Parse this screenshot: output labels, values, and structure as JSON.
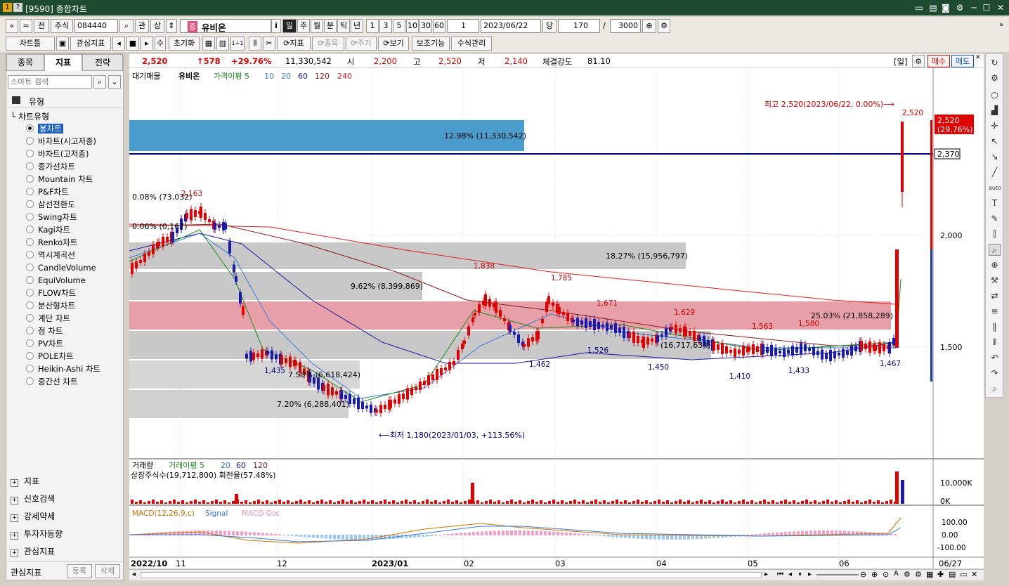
{
  "window": {
    "title": "[9590] 종합차트",
    "icons": [
      "1",
      "?"
    ]
  },
  "toolbar1": {
    "nav_first": "«",
    "nav_prev": "≈",
    "before": "전",
    "market": "주식",
    "code": "084440",
    "search_icon": "⌕",
    "gwan": "관",
    "sang": "상",
    "badge": "증",
    "stock_name": "유비온",
    "info": "i",
    "periods": [
      "일",
      "주",
      "월",
      "분",
      "틱",
      "년"
    ],
    "intervals": [
      "1",
      "3",
      "5",
      "10",
      "30",
      "60"
    ],
    "count_select": "1",
    "date": "2023/06/22",
    "dang": "당",
    "bars": "170",
    "slash": "/",
    "total": "3000"
  },
  "toolbar2": {
    "chart_type": "차트틀",
    "watch_indicator": "관심지표",
    "su": "수",
    "reset": "초기화",
    "indicator": "지표",
    "stock": "종목",
    "cycle": "주기",
    "view": "보기",
    "aux": "보조기능",
    "formula": "수식관리"
  },
  "left_panel": {
    "tabs": [
      "종목",
      "지표",
      "전략"
    ],
    "search_placeholder": "스마트 검색",
    "section_type": "유형",
    "tree_root": "차트유형",
    "items": [
      "봉차트",
      "바차트(시고저종)",
      "바차트(고저종)",
      "종가선차트",
      "Mountain 차트",
      "P&F차트",
      "삼선전환도",
      "Swing차트",
      "Kagi차트",
      "Renko차트",
      "역시계곡선",
      "CandleVolume",
      "EquiVolume",
      "FLOW차트",
      "분산형차트",
      "계단 차트",
      "점 차트",
      "PV차트",
      "POLE차트",
      "Heikin-Ashi 차트",
      "중간선 차트"
    ],
    "selected_index": 0,
    "sections": [
      "지표",
      "신호검색",
      "강세약세",
      "투자자동향",
      "관심지표"
    ],
    "bottom": {
      "label": "관심지표",
      "register": "등록",
      "delete": "삭제"
    }
  },
  "infobar": {
    "price": "2,520",
    "change": "↑578",
    "pct": "+29.76%",
    "volume": "11,330,542",
    "open_label": "시",
    "open": "2,200",
    "high_label": "고",
    "high": "2,520",
    "low_label": "저",
    "low": "2,140",
    "strength_label": "체결강도",
    "strength": "81.10",
    "day": "[일]",
    "buy": "매수",
    "sell": "매도"
  },
  "chart_legend": {
    "items": [
      "대기매물",
      "유비온",
      "가격이평 5",
      "10",
      "20",
      "60",
      "120",
      "240"
    ],
    "colors": [
      "#000",
      "#000",
      "#1a8a1a",
      "#3a78d8",
      "#3a78d8",
      "#1a1aa0",
      "#8a1a1a",
      "#e02020"
    ]
  },
  "chart_annotations": {
    "high": "최고 2,520(2023/06/22, 0.00%)⟶",
    "low": "⟵최저 1,180(2023/01/03, +113.56%)",
    "price_tag": "2,520",
    "price_pct": "(29.76%)",
    "line_tag": "2,370",
    "bars": [
      "12.98% (11,330,542)",
      "0.08% (73,032)",
      "0.06% (0,167)",
      "18.27% (15,956,797)",
      "9.62% (8,399,869)",
      "25.03% (21,858,289)",
      "(16,717,634)",
      "7.58% (6,618,424)",
      "7.20% (6,288,401)"
    ],
    "peaks": [
      "2,163",
      "1,838",
      "1,785",
      "1,671",
      "1,629",
      "1,563",
      "1,580",
      "2,520"
    ],
    "troughs": [
      "1,435",
      "1,462",
      "1,526",
      "1,450",
      "1,410",
      "1,433",
      "1,467"
    ]
  },
  "price_axis": [
    "2,000",
    "1,500"
  ],
  "volume_panel": {
    "legend": [
      "거래량",
      "거래이평 5",
      "20",
      "60",
      "120"
    ],
    "info": "상장주식수(19,712,800) 회전율(57.48%)",
    "axis": [
      "10,000K",
      "0K"
    ]
  },
  "macd_panel": {
    "legend": [
      "MACD(12,26,9,c)",
      "Signal",
      "MACD Osc"
    ],
    "axis": [
      "100.00",
      "0.00",
      "-100.00"
    ]
  },
  "x_axis": {
    "labels": [
      "2022/10",
      "11",
      "12",
      "2023/01",
      "02",
      "03",
      "04",
      "05",
      "06",
      "06/27"
    ]
  },
  "chart_data": {
    "type": "candlestick",
    "title": "유비온",
    "date_range": [
      "2022/10",
      "2023/06/22"
    ],
    "ylim": [
      1100,
      2600
    ],
    "last": 2520,
    "high": {
      "value": 2520,
      "date": "2023/06/22"
    },
    "low": {
      "value": 1180,
      "date": "2023/01/03"
    },
    "reference_line": 2370,
    "volume_profile": [
      {
        "pct": 12.98,
        "volume": 11330542
      },
      {
        "pct": 18.27,
        "volume": 15956797
      },
      {
        "pct": 9.62,
        "volume": 8399869
      },
      {
        "pct": 25.03,
        "volume": 21858289
      },
      {
        "pct": 7.58,
        "volume": 6618424
      },
      {
        "pct": 7.2,
        "volume": 6288401
      },
      {
        "pct": 0.08,
        "volume": 73032
      }
    ],
    "series": [
      {
        "name": "가격이평 5"
      },
      {
        "name": "10"
      },
      {
        "name": "20"
      },
      {
        "name": "60"
      },
      {
        "name": "120"
      },
      {
        "name": "240"
      }
    ]
  }
}
